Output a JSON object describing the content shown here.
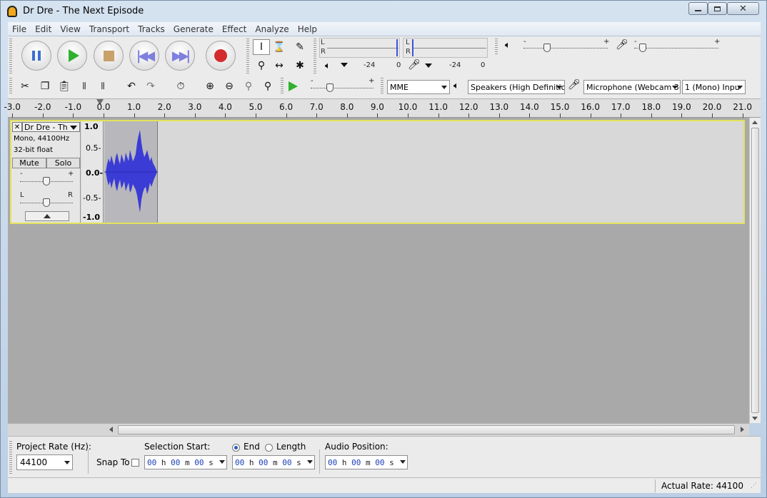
{
  "window": {
    "title": "Dr Dre - The Next Episode"
  },
  "menu": [
    "File",
    "Edit",
    "View",
    "Transport",
    "Tracks",
    "Generate",
    "Effect",
    "Analyze",
    "Help"
  ],
  "transport_buttons": [
    "pause",
    "play",
    "stop",
    "skip-to-start",
    "skip-to-end",
    "record"
  ],
  "meters": {
    "play_left": "L",
    "play_right": "R",
    "rec_left": "L",
    "rec_right": "R",
    "play_db_min": "-24",
    "play_db_zero": "0",
    "rec_db_min": "-24",
    "rec_db_zero": "0"
  },
  "mixer": {
    "output_minus": "-",
    "output_plus": "+",
    "input_minus": "-",
    "input_plus": "+",
    "output_level": 0.28,
    "input_level": 0.1
  },
  "play_at_speed": {
    "minus": "-",
    "plus": "+"
  },
  "devices": {
    "host": "MME",
    "output": "Speakers (High Definitio",
    "input": "Microphone (Webcam 3(",
    "channels": "1 (Mono) Inpu"
  },
  "ruler": {
    "ticks": [
      "-3.0",
      "-2.0",
      "-1.0",
      "0.0",
      "1.0",
      "2.0",
      "3.0",
      "4.0",
      "5.0",
      "6.0",
      "7.0",
      "8.0",
      "9.0",
      "10.0",
      "11.0",
      "12.0",
      "13.0",
      "14.0",
      "15.0",
      "16.0",
      "17.0",
      "18.0",
      "19.0",
      "20.0",
      "21.0"
    ]
  },
  "track": {
    "name": "Dr Dre - Th",
    "format": "Mono, 44100Hz",
    "bit_depth": "32-bit float",
    "mute_label": "Mute",
    "solo_label": "Solo",
    "gain_minus": "-",
    "gain_plus": "+",
    "pan_left": "L",
    "pan_right": "R",
    "close_glyph": "✕",
    "vruler": [
      "1.0",
      "0.5-",
      "0.0-",
      "-0.5-",
      "-1.0"
    ]
  },
  "selection_toolbar": {
    "project_rate_label": "Project Rate (Hz):",
    "project_rate_value": "44100",
    "snap_to_label": "Snap To",
    "selection_start_label": "Selection Start:",
    "end_label": "End",
    "length_label": "Length",
    "audio_position_label": "Audio Position:",
    "time_h": "h",
    "time_m": "m",
    "time_s": "s",
    "time_zero": "00"
  },
  "status": {
    "actual_rate": "Actual Rate: 44100"
  },
  "colors": {
    "track_selected_border": "#e5e25a",
    "waveform": "#3b3bd6",
    "record_red": "#d42c2c",
    "play_green": "#2fb12f"
  }
}
